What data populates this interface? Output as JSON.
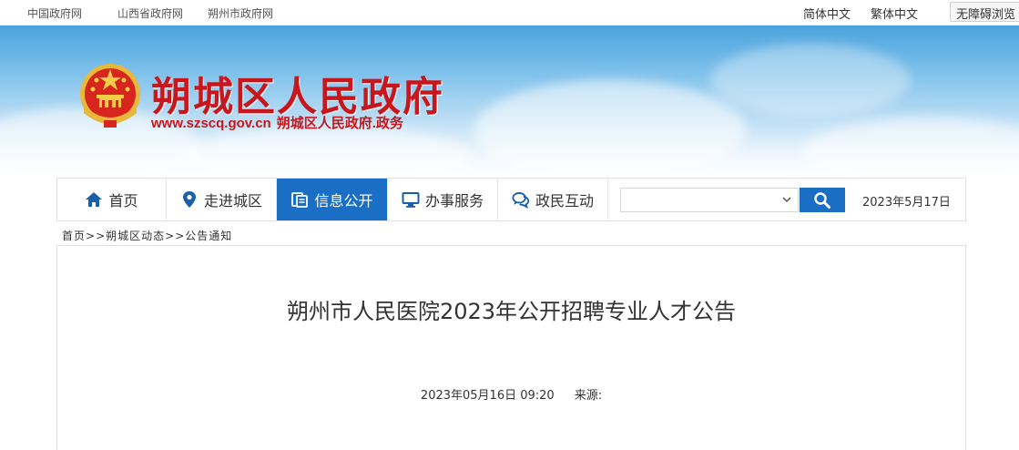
{
  "topbar": {
    "links": [
      "中国政府网",
      "山西省政府网",
      "朔州市政府网"
    ],
    "lang_simplified": "简体中文",
    "lang_traditional": "繁体中文",
    "accessibility": "无障碍浏览"
  },
  "banner": {
    "title": "朔城区人民政府",
    "url": "www.szscq.gov.cn",
    "subtitle": "朔城区人民政府.政务"
  },
  "nav": {
    "items": [
      {
        "label": "首页",
        "icon": "home-icon"
      },
      {
        "label": "走进城区",
        "icon": "map-pin-icon"
      },
      {
        "label": "信息公开",
        "icon": "document-icon"
      },
      {
        "label": "办事服务",
        "icon": "monitor-icon"
      },
      {
        "label": "政民互动",
        "icon": "chat-icon"
      }
    ],
    "active_index": 2,
    "search_value": "",
    "date": "2023年5月17日"
  },
  "breadcrumb": {
    "items": [
      "首页",
      "朔城区动态",
      "公告通知"
    ],
    "separator": ">>"
  },
  "article": {
    "title": "朔州市人民医院2023年公开招聘专业人才公告",
    "datetime": "2023年05月16日 09:20",
    "source_label": "来源:",
    "source_value": ""
  },
  "colors": {
    "accent": "#1a6fc4",
    "brand_red": "#c8161d"
  }
}
